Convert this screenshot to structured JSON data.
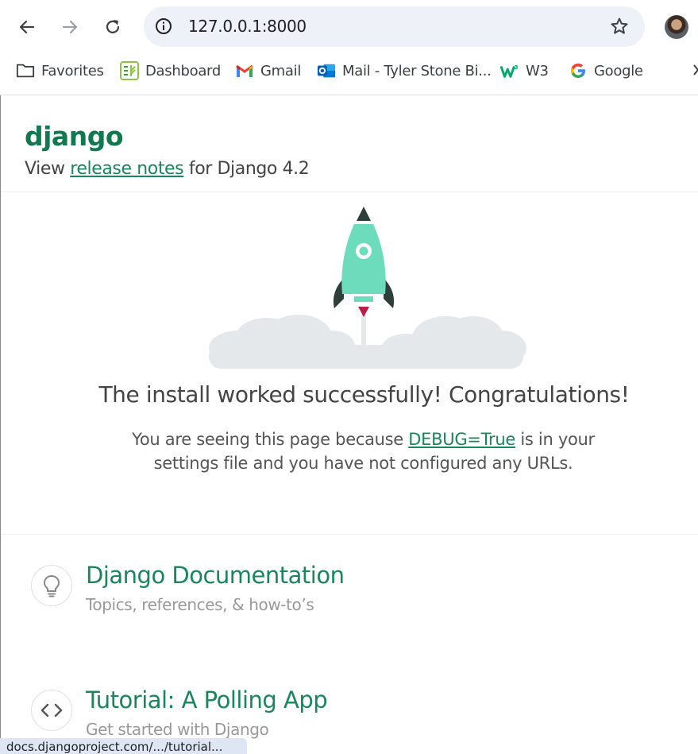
{
  "browser": {
    "url": "127.0.0.1:8000",
    "bookmarks": [
      {
        "label": "Favorites",
        "icon": "folder-icon"
      },
      {
        "label": "Dashboard",
        "icon": "dashboard-icon"
      },
      {
        "label": "Gmail",
        "icon": "gmail-icon"
      },
      {
        "label": "Mail - Tyler Stone Bi...",
        "icon": "outlook-icon"
      },
      {
        "label": "W3",
        "icon": "w3-icon"
      },
      {
        "label": "Google",
        "icon": "google-icon"
      }
    ],
    "status_url": "docs.djangoproject.com/.../tutorial..."
  },
  "page": {
    "logo": "django",
    "release_prefix": "View ",
    "release_link": "release notes",
    "release_suffix": " for Django 4.2",
    "headline": "The install worked successfully! Congratulations!",
    "sub_prefix": "You are seeing this page because ",
    "sub_link": "DEBUG=True",
    "sub_suffix": " is in your settings file and you have not configured any URLs.",
    "cards": [
      {
        "title": "Django Documentation",
        "subtitle": "Topics, references, & how-to’s",
        "icon": "lightbulb-icon"
      },
      {
        "title": "Tutorial: A Polling App",
        "subtitle": "Get started with Django",
        "icon": "code-icon"
      }
    ]
  },
  "colors": {
    "django_green": "#19865c",
    "rocket_body": "#6ddcbd",
    "rocket_dark": "#2e3e38",
    "flame": "#b91d48",
    "cloud": "#e4e8ea"
  }
}
